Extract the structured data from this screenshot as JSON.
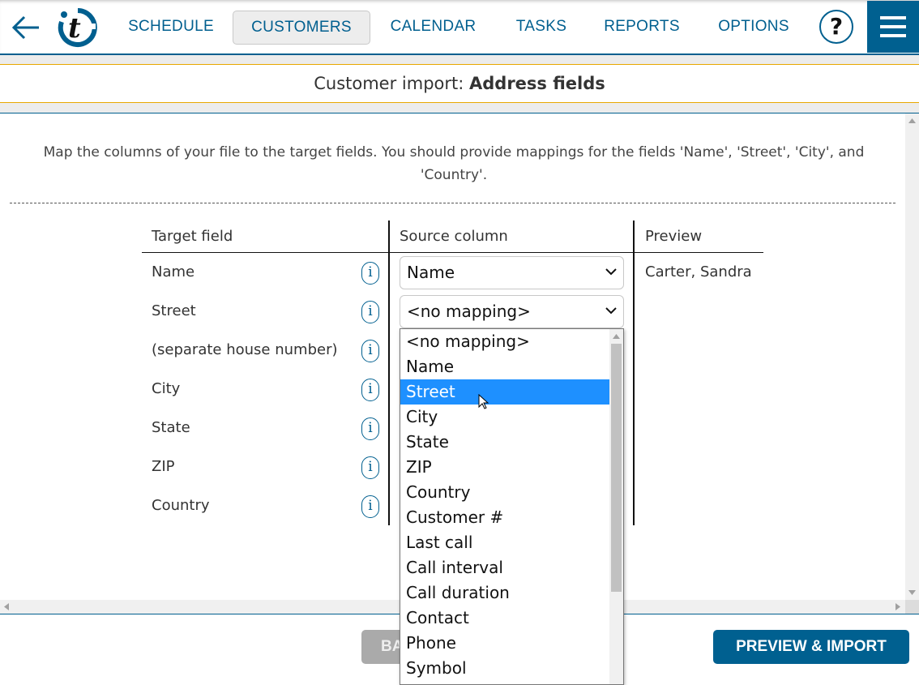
{
  "header": {
    "nav": [
      {
        "label": "SCHEDULE",
        "active": false
      },
      {
        "label": "CUSTOMERS",
        "active": true
      },
      {
        "label": "CALENDAR",
        "active": false
      },
      {
        "label": "TASKS",
        "active": false
      },
      {
        "label": "REPORTS",
        "active": false
      },
      {
        "label": "OPTIONS",
        "active": false
      }
    ],
    "help": "?",
    "logo_letter": "t"
  },
  "page": {
    "title_prefix": "Customer import: ",
    "title_bold": "Address fields",
    "intro": "Map the columns of your file to the target fields. You should provide mappings for the fields 'Name', 'Street', 'City', and 'Country'."
  },
  "table": {
    "headers": [
      "Target field",
      "Source column",
      "Preview"
    ],
    "rows": [
      {
        "field": "Name",
        "source": "Name",
        "preview": "Carter, Sandra"
      },
      {
        "field": "Street",
        "source": "<no mapping>",
        "preview": ""
      },
      {
        "field": "(separate house number)"
      },
      {
        "field": "City"
      },
      {
        "field": "State"
      },
      {
        "field": "ZIP"
      },
      {
        "field": "Country"
      }
    ]
  },
  "dropdown": {
    "options": [
      "<no mapping>",
      "Name",
      "Street",
      "City",
      "State",
      "ZIP",
      "Country",
      "Customer #",
      "Last call",
      "Call interval",
      "Call duration",
      "Contact",
      "Phone",
      "Symbol"
    ],
    "highlighted": "Street"
  },
  "footer": {
    "back": "BACK",
    "import": "PREVIEW & IMPORT"
  },
  "colors": {
    "brand": "#006090",
    "accent_line": "#e8a800",
    "highlight": "#1e90ff"
  }
}
